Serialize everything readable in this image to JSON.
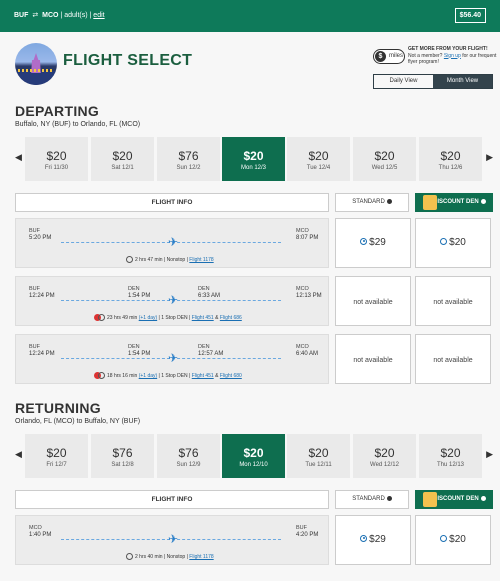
{
  "topbar": {
    "route_from": "BUF",
    "route_to": "MCO",
    "route_arrow": "⇄",
    "travelers": "| adult(s) |",
    "edit": "edit",
    "total": "$56.40"
  },
  "header": {
    "title": "FLIGHT SELECT",
    "miles_label": "miles",
    "promo_head": "GET MORE FROM YOUR FLIGHT!",
    "promo_text_1": "Not a member? ",
    "promo_link": "Sign up",
    "promo_text_2": " for our frequent flyer program!",
    "view_daily": "Daily View",
    "view_month": "Month View"
  },
  "departing": {
    "title": "DEPARTING",
    "subtitle": "Buffalo, NY (BUF) to Orlando, FL (MCO)",
    "dates": [
      {
        "price": "$20",
        "label": "Fri 11/30"
      },
      {
        "price": "$20",
        "label": "Sat 12/1"
      },
      {
        "price": "$76",
        "label": "Sun 12/2"
      },
      {
        "price": "$20",
        "label": "Mon 12/3"
      },
      {
        "price": "$20",
        "label": "Tue 12/4"
      },
      {
        "price": "$20",
        "label": "Wed 12/5"
      },
      {
        "price": "$20",
        "label": "Thu 12/6"
      }
    ],
    "flights": [
      {
        "dep_apt": "BUF",
        "dep_time": "5:20 PM",
        "arr_apt": "MCO",
        "arr_time": "8:07 PM",
        "duration": "2 hrs 47 min",
        "stops": "Nonstop",
        "flight": "Flight 1178",
        "std": "$29",
        "dd": "$20"
      },
      {
        "dep_apt": "BUF",
        "dep_time": "12:24 PM",
        "mid1_apt": "DEN",
        "mid1_time": "1:54 PM",
        "mid2_apt": "DEN",
        "mid2_time": "6:33 AM",
        "arr_apt": "MCO",
        "arr_time": "12:13 PM",
        "duration": "23 hrs 49 min",
        "next_day": "(+1 day)",
        "stops": "1 Stop DEN",
        "flight": "Flight 451",
        "flight2": "Flight 686",
        "std": "not available",
        "dd": "not available"
      },
      {
        "dep_apt": "BUF",
        "dep_time": "12:24 PM",
        "mid1_apt": "DEN",
        "mid1_time": "1:54 PM",
        "mid2_apt": "DEN",
        "mid2_time": "12:57 AM",
        "arr_apt": "MCO",
        "arr_time": "6:40 AM",
        "duration": "18 hrs 16 min",
        "next_day": "(+1 day)",
        "stops": "1 Stop DEN",
        "flight": "Flight 451",
        "flight2": "Flight 680",
        "std": "not available",
        "dd": "not available"
      }
    ]
  },
  "returning": {
    "title": "RETURNING",
    "subtitle": "Orlando, FL (MCO) to Buffalo, NY (BUF)",
    "dates": [
      {
        "price": "$20",
        "label": "Fri 12/7"
      },
      {
        "price": "$76",
        "label": "Sat 12/8"
      },
      {
        "price": "$76",
        "label": "Sun 12/9"
      },
      {
        "price": "$20",
        "label": "Mon 12/10"
      },
      {
        "price": "$20",
        "label": "Tue 12/11"
      },
      {
        "price": "$20",
        "label": "Wed 12/12"
      },
      {
        "price": "$20",
        "label": "Thu 12/13"
      }
    ],
    "flights": [
      {
        "dep_apt": "MCO",
        "dep_time": "1:40 PM",
        "arr_apt": "BUF",
        "arr_time": "4:20 PM",
        "duration": "2 hrs 40 min",
        "stops": "Nonstop",
        "flight": "Flight 1178",
        "std": "$29",
        "dd": "$20"
      }
    ]
  },
  "table": {
    "flight_info": "FLIGHT INFO",
    "standard": "STANDARD",
    "discount_den": "DISCOUNT DEN"
  },
  "colors": {
    "brand_green": "#0e7a5a",
    "selected_date": "#0e6e4f",
    "link_blue": "#1a6fb3"
  }
}
